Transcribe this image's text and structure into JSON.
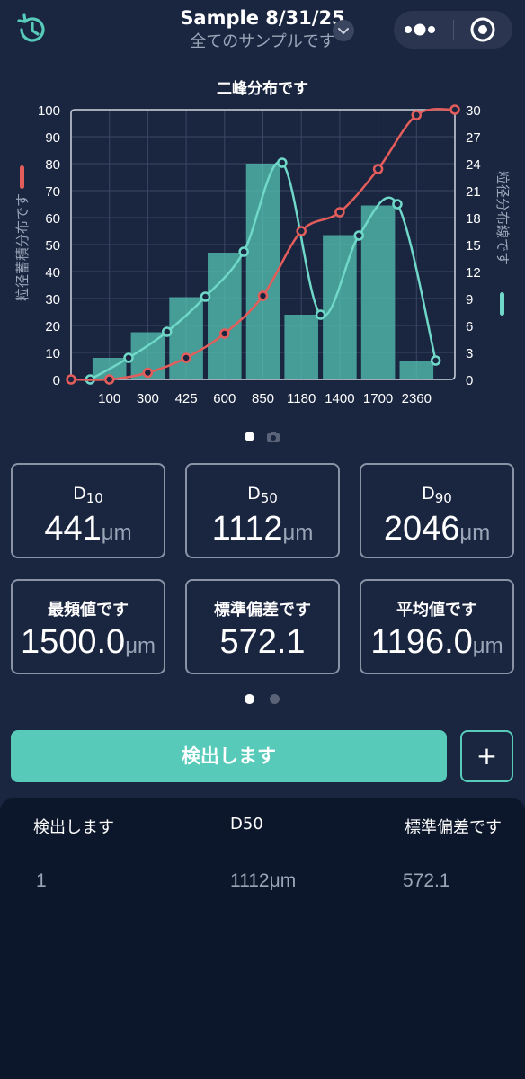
{
  "header": {
    "title": "Sample 8/31/25",
    "subtitle": "全てのサンプルです"
  },
  "chart_data": {
    "type": "bar",
    "title": "二峰分布です",
    "categories": [
      "100",
      "300",
      "425",
      "600",
      "850",
      "1180",
      "1400",
      "1700",
      "2360"
    ],
    "left_axis_label": "粒径蓄積分布です",
    "right_axis_label": "粒径分布線です",
    "left_ylim": [
      0,
      100
    ],
    "right_ylim": [
      0,
      30
    ],
    "left_ticks": [
      "0",
      "10",
      "20",
      "30",
      "40",
      "50",
      "60",
      "70",
      "80",
      "90",
      "100"
    ],
    "right_ticks": [
      "0",
      "3",
      "6",
      "9",
      "12",
      "15",
      "18",
      "21",
      "24",
      "27",
      "30"
    ],
    "bars": [
      8,
      17.5,
      30.5,
      47,
      80,
      24,
      53.5,
      64.5,
      6.7
    ],
    "distribution_curve": [
      0,
      2.4,
      5.3,
      9.2,
      14.2,
      24.1,
      7.2,
      16,
      19.5,
      2.1
    ],
    "cumulative_curve": [
      0,
      0,
      2.5,
      8,
      17,
      31,
      55,
      62,
      78,
      98,
      100
    ],
    "grid": true,
    "colors": {
      "bars": "#58cab9",
      "distribution": "#6fd8c8",
      "cumulative": "#e35d5b"
    }
  },
  "stats": {
    "d10": {
      "label": "D",
      "sub": "10",
      "value": "441",
      "unit": "μm"
    },
    "d50": {
      "label": "D",
      "sub": "50",
      "value": "1112",
      "unit": "μm"
    },
    "d90": {
      "label": "D",
      "sub": "90",
      "value": "2046",
      "unit": "μm"
    },
    "mode": {
      "label": "最頻値です",
      "value": "1500.0",
      "unit": "μm"
    },
    "std": {
      "label": "標準偏差です",
      "value": "572.1"
    },
    "mean": {
      "label": "平均値です",
      "value": "1196.0",
      "unit": "μm"
    }
  },
  "actions": {
    "detect_label": "検出します",
    "add_label": "+"
  },
  "table": {
    "headers": [
      "検出します",
      "D50",
      "標準偏差です"
    ],
    "rows": [
      {
        "index": "1",
        "d50": "1112μm",
        "std": "572.1"
      }
    ]
  }
}
